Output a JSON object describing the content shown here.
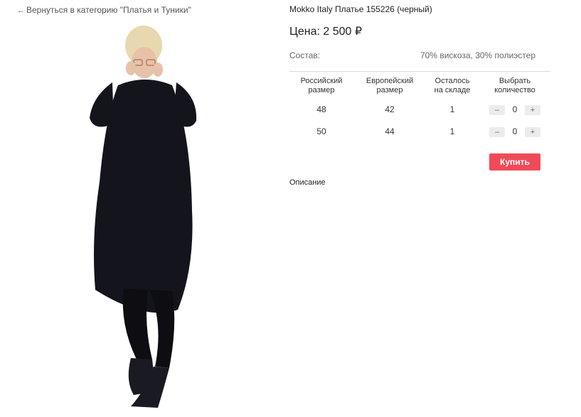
{
  "nav": {
    "back_arrow": "←",
    "back_label": "Вернуться в категорию \"Платья и Туники\""
  },
  "product": {
    "title": "Mokko Italy Платье 155226 (черный)",
    "price": "Цена: 2 500 ₽",
    "composition_label": "Состав:",
    "composition_value": "70% вискоза, 30% полиэстер"
  },
  "sizes_table": {
    "headers": [
      "Российский\nразмер",
      "Европейский\nразмер",
      "Осталось\nна складе",
      "Выбрать\nколичество"
    ],
    "rows": [
      {
        "ru": "48",
        "eu": "42",
        "stock": "1",
        "qty": "0"
      },
      {
        "ru": "50",
        "eu": "44",
        "stock": "1",
        "qty": "0"
      }
    ],
    "minus_label": "–",
    "plus_label": "+"
  },
  "buy_label": "Купить",
  "description_label": "Описание",
  "colors": {
    "buy_button": "#f04a58",
    "dress": "#14141c"
  }
}
